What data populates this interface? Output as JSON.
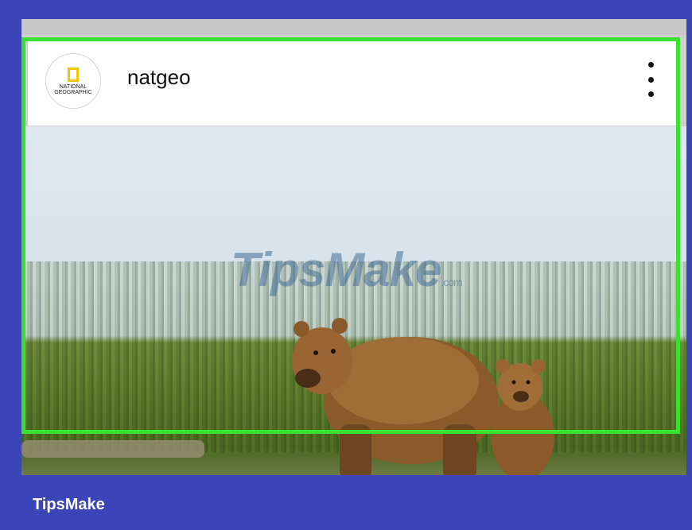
{
  "post": {
    "username": "natgeo",
    "avatar_text": "NATIONAL GEOGRAPHIC",
    "menu_icon": "more-vertical-icon"
  },
  "watermark": {
    "main": "TipsMake",
    "suffix": ".com"
  },
  "footer": {
    "brand": "TipsMake"
  },
  "colors": {
    "background": "#3b45b7",
    "highlight": "#39e22f",
    "natgeo_yellow": "#f2c500"
  }
}
